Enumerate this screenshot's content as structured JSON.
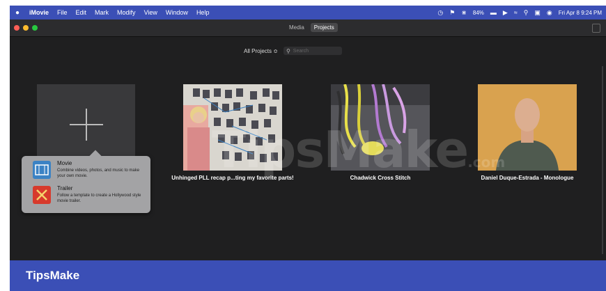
{
  "menubar": {
    "apple": "",
    "app_name": "iMovie",
    "items": [
      "File",
      "Edit",
      "Mark",
      "Modify",
      "View",
      "Window",
      "Help"
    ],
    "battery": "84%",
    "datetime": "Fri Apr 8  9:24 PM"
  },
  "window": {
    "tabs": [
      {
        "label": "Media",
        "active": false
      },
      {
        "label": "Projects",
        "active": true
      }
    ]
  },
  "toolbar": {
    "filter_label": "All Projects ≎",
    "search_placeholder": "Search"
  },
  "projects": [
    {
      "title": "Unhinged PLL recap p...ting my favorite parts!"
    },
    {
      "title": "Chadwick Cross Stitch"
    },
    {
      "title": "Daniel Duque-Estrada - Monologue"
    }
  ],
  "new_project_popup": {
    "options": [
      {
        "label": "Movie",
        "description": "Combine videos, photos, and music to make your own movie.",
        "icon": "movie-icon"
      },
      {
        "label": "Trailer",
        "description": "Follow a template to create a Hollywood style movie trailer.",
        "icon": "trailer-icon"
      }
    ]
  },
  "watermark": {
    "main": "TipsMake",
    "suffix": ".com"
  },
  "footer": {
    "brand": "TipsMake"
  },
  "colors": {
    "menubar": "#3b4fb6",
    "window_bg": "#1f1f20",
    "popup_bg": "#a3a3a5",
    "accent_blue": "#3b82c4",
    "trailer_red": "#d73a2c"
  }
}
